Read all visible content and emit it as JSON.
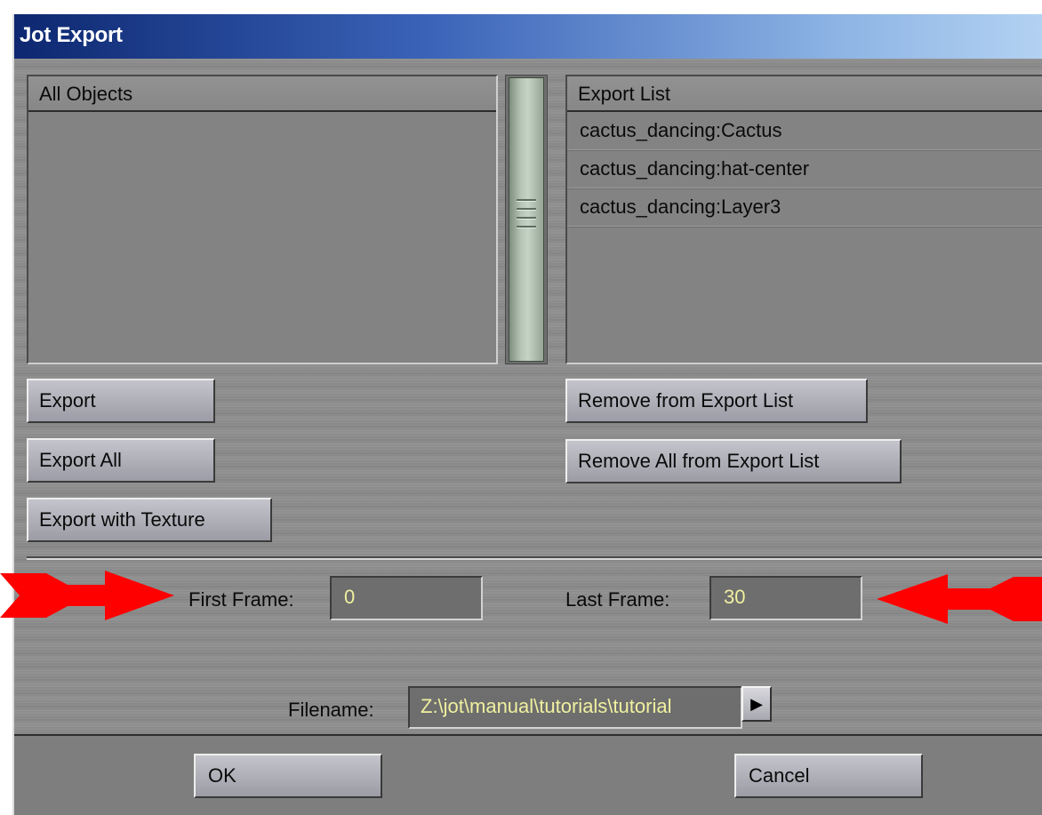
{
  "window": {
    "title": "Jot Export"
  },
  "all_objects": {
    "header": "All Objects",
    "items": []
  },
  "export_list": {
    "header": "Export List",
    "items": [
      "cactus_dancing:Cactus",
      "cactus_dancing:hat-center",
      "cactus_dancing:Layer3"
    ]
  },
  "buttons": {
    "export": "Export",
    "export_all": "Export All",
    "export_with_texture": "Export with Texture",
    "remove_from_list": "Remove from Export List",
    "remove_all_from_list": "Remove All from Export List",
    "ok": "OK",
    "cancel": "Cancel"
  },
  "frames": {
    "first_label": "First Frame:",
    "first_value": "0",
    "last_label": "Last Frame:",
    "last_value": "30"
  },
  "file": {
    "label": "Filename:",
    "value": "Z:\\jot\\manual\\tutorials\\tutorial",
    "browse_icon": "play-right-icon"
  },
  "annotations": {
    "arrow_color": "#ff0000",
    "left_arrow_icon": "red-arrow-right-icon",
    "right_arrow_icon": "red-arrow-left-icon"
  }
}
